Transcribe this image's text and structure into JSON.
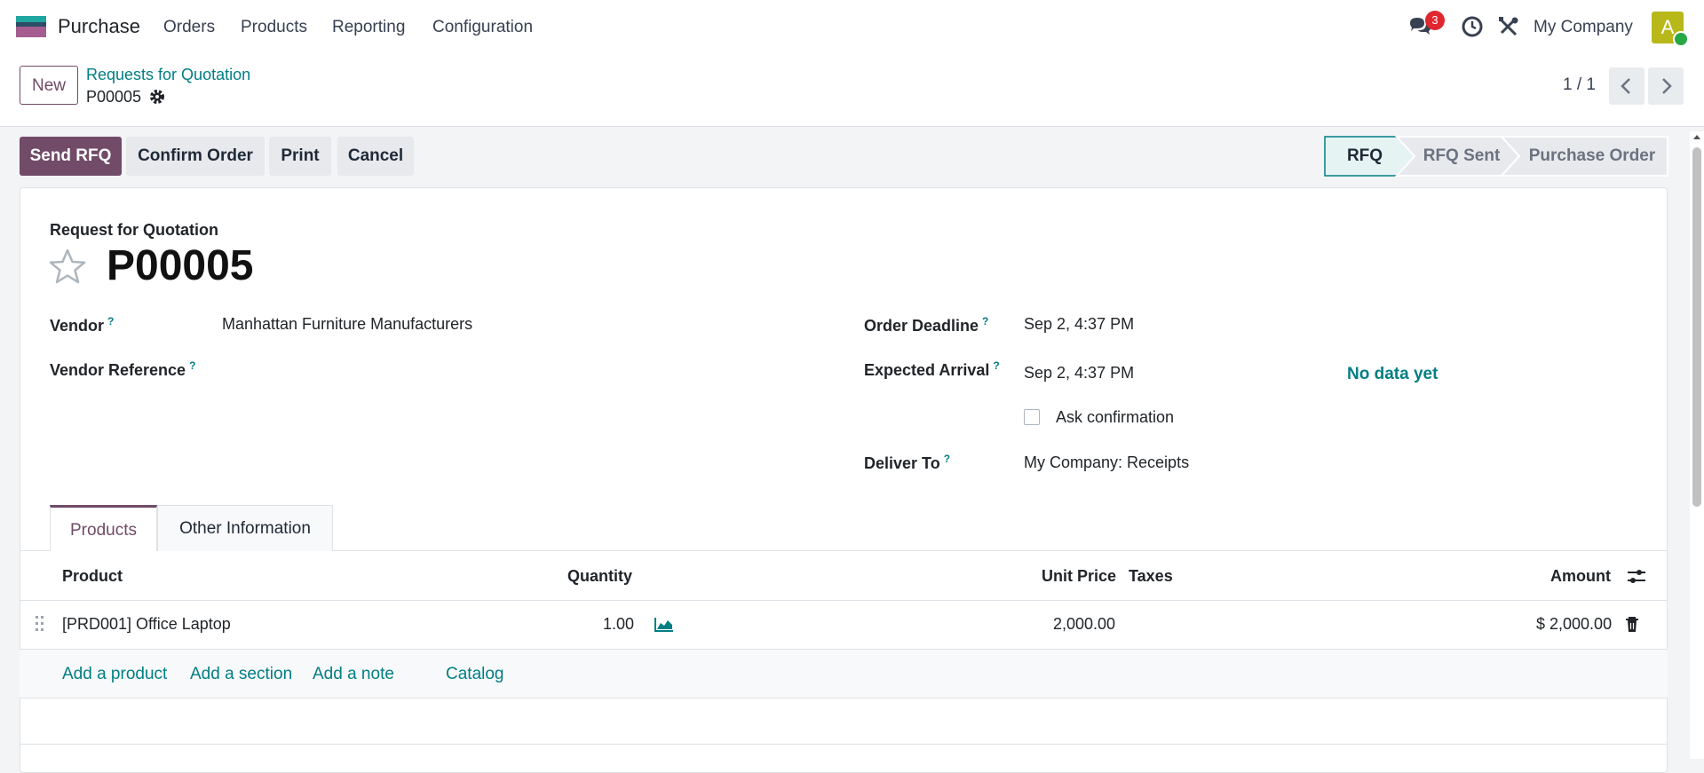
{
  "app": {
    "name": "Purchase",
    "menu": [
      "Orders",
      "Products",
      "Reporting",
      "Configuration"
    ],
    "notifications_count": "3",
    "company": "My Company",
    "avatar_letter": "A"
  },
  "control": {
    "new_label": "New",
    "breadcrumb_parent": "Requests for Quotation",
    "breadcrumb_current": "P00005",
    "pager": "1 / 1"
  },
  "actions": {
    "send_rfq": "Send RFQ",
    "confirm_order": "Confirm Order",
    "print": "Print",
    "cancel": "Cancel"
  },
  "status": {
    "steps": [
      "RFQ",
      "RFQ Sent",
      "Purchase Order"
    ],
    "active_index": 0
  },
  "form": {
    "subtitle": "Request for Quotation",
    "title": "P00005",
    "vendor_label": "Vendor",
    "vendor_value": "Manhattan Furniture Manufacturers",
    "vendor_ref_label": "Vendor Reference",
    "order_deadline_label": "Order Deadline",
    "order_deadline_value": "Sep 2, 4:37 PM",
    "expected_arrival_label": "Expected Arrival",
    "expected_arrival_value": "Sep 2, 4:37 PM",
    "no_data": "No data yet",
    "ask_confirmation_label": "Ask confirmation",
    "deliver_to_label": "Deliver To",
    "deliver_to_value": "My Company: Receipts",
    "help_mark": "?"
  },
  "tabs": [
    "Products",
    "Other Information"
  ],
  "lines": {
    "headers": {
      "product": "Product",
      "quantity": "Quantity",
      "unit_price": "Unit Price",
      "taxes": "Taxes",
      "amount": "Amount"
    },
    "rows": [
      {
        "product": "[PRD001] Office Laptop",
        "quantity": "1.00",
        "unit_price": "2,000.00",
        "taxes": "",
        "amount": "$ 2,000.00"
      }
    ],
    "add_product": "Add a product",
    "add_section": "Add a section",
    "add_note": "Add a note",
    "catalog": "Catalog"
  },
  "colors": {
    "primary": "#714b67",
    "link": "#017e84"
  }
}
